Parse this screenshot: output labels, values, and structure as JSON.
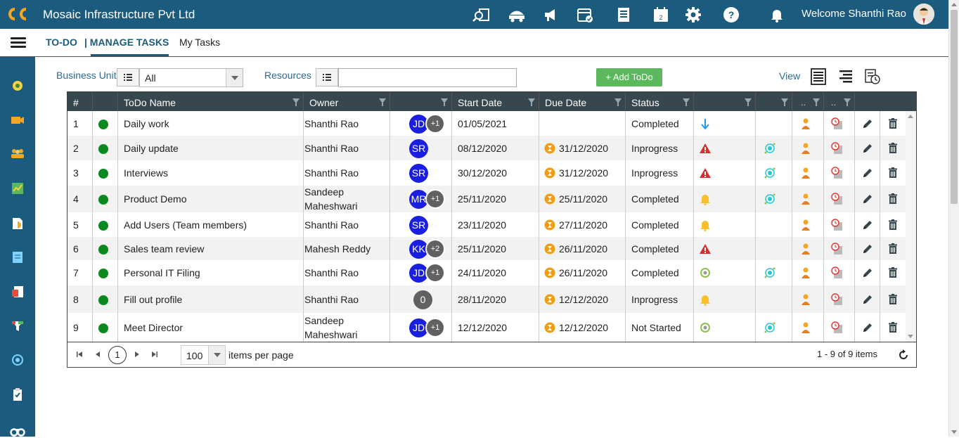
{
  "app": {
    "company": "Mosaic Infrastructure Pvt Ltd",
    "welcome": "Welcome Shanthi Rao"
  },
  "top_icons": [
    "search-report-icon",
    "delivery-truck-icon",
    "megaphone-icon",
    "calendar-check-icon",
    "checklist-icon",
    "calendar-2-icon",
    "gear-icon",
    "help-icon",
    "bell-icon"
  ],
  "subnav": {
    "tab_todo": "TO-DO",
    "tab_manage": "| MANAGE TASKS",
    "tab_mytasks": "My Tasks"
  },
  "sidebar_icons": [
    "dashboard-icon",
    "video-icon",
    "team-icon",
    "chart-icon",
    "document-icon",
    "book-icon",
    "report-icon",
    "funnel-icon",
    "target-icon",
    "clipboard-icon",
    "binoculars-icon"
  ],
  "filters": {
    "business_unit_label": "Business Unit",
    "business_unit_value": "All",
    "resources_label": "Resources",
    "resources_value": "",
    "add_todo_label": "+ Add ToDo",
    "view_label": "View"
  },
  "grid": {
    "headers": {
      "num": "#",
      "name": "ToDo Name",
      "owner": "Owner",
      "start": "Start Date",
      "due": "Due Date",
      "status": "Status",
      "col_a": "..",
      "col_b": ".."
    },
    "rows": [
      {
        "num": "1",
        "name": "Daily work",
        "owner": [
          "Shanthi Rao"
        ],
        "badge": "JD",
        "extra": "+1",
        "start": "01/05/2021",
        "due": "",
        "status": "Completed",
        "flag": "arrow-down",
        "target": false
      },
      {
        "num": "2",
        "name": "Daily update",
        "owner": [
          "Shanthi Rao"
        ],
        "badge": "SR",
        "extra": "",
        "start": "08/12/2020",
        "due": "31/12/2020",
        "status": "Inprogress",
        "flag": "warning",
        "target": true
      },
      {
        "num": "3",
        "name": "Interviews",
        "owner": [
          "Shanthi Rao"
        ],
        "badge": "SR",
        "extra": "",
        "start": "30/12/2020",
        "due": "31/12/2020",
        "status": "Inprogress",
        "flag": "warning",
        "target": true
      },
      {
        "num": "4",
        "name": "Product Demo",
        "owner": [
          "Sandeep",
          "Maheshwari"
        ],
        "badge": "MR",
        "extra": "+1",
        "start": "25/11/2020",
        "due": "25/11/2020",
        "status": "Completed",
        "flag": "bell",
        "target": true
      },
      {
        "num": "5",
        "name": "Add Users (Team members)",
        "owner": [
          "Shanthi Rao"
        ],
        "badge": "SR",
        "extra": "",
        "start": "23/11/2020",
        "due": "27/11/2020",
        "status": "Completed",
        "flag": "bell",
        "target": false
      },
      {
        "num": "6",
        "name": "Sales team review",
        "owner": [
          "Mahesh Reddy"
        ],
        "badge": "KK",
        "extra": "+2",
        "start": "25/11/2020",
        "due": "26/11/2020",
        "status": "Completed",
        "flag": "warning",
        "target": false
      },
      {
        "num": "7",
        "name": "Personal IT Filing",
        "owner": [
          "Shanthi Rao"
        ],
        "badge": "JD",
        "extra": "+1",
        "start": "24/11/2020",
        "due": "26/11/2020",
        "status": "Completed",
        "flag": "circle",
        "target": true
      },
      {
        "num": "8",
        "name": "Fill out profile",
        "owner": [
          "Shanthi Rao"
        ],
        "badge": "0",
        "extra": "",
        "start": "28/11/2020",
        "due": "12/12/2020",
        "status": "Inprogress",
        "flag": "bell",
        "target": false
      },
      {
        "num": "9",
        "name": "Meet Director",
        "owner": [
          "Sandeep",
          "Maheshwari"
        ],
        "badge": "JD",
        "extra": "+1",
        "start": "12/12/2020",
        "due": "12/12/2020",
        "status": "Not Started",
        "flag": "circle",
        "target": true
      }
    ]
  },
  "pager": {
    "current_page": "1",
    "page_size": "100",
    "items_per_page": "items per page",
    "count": "1 - 9 of 9 items"
  },
  "colors": {
    "brand": "#1b5b7e",
    "header": "#37474f",
    "badge": "#1a1ee0",
    "status_dot": "#0a8a1e",
    "add_button": "#5cb85c"
  }
}
